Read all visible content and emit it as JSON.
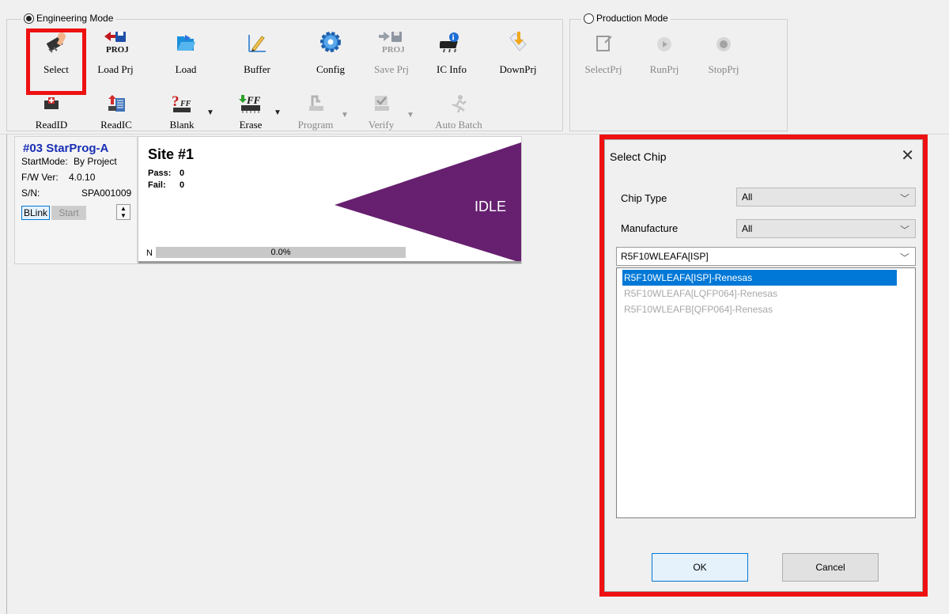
{
  "modes": {
    "engineering": "Engineering Mode",
    "production": "Production Mode"
  },
  "toolbar": {
    "row1": [
      "Select",
      "Load Prj",
      "Load",
      "Buffer",
      "Config",
      "Save Prj",
      "IC Info",
      "DownPrj"
    ],
    "row2": [
      "ReadID",
      "ReadIC",
      "Blank",
      "Erase",
      "Program",
      "Verify",
      "Auto Batch"
    ],
    "production": [
      "SelectPrj",
      "RunPrj",
      "StopPrj"
    ]
  },
  "device": {
    "title": "#03 StarProg-A",
    "start_mode_label": "StartMode:",
    "start_mode_value": "By Project",
    "fw_label": "F/W Ver:",
    "fw_value": "4.0.10",
    "sn_label": "S/N:",
    "sn_value": "SPA001009",
    "blink_label": "BLink",
    "start_label": "Start"
  },
  "site": {
    "title": "Site #1",
    "pass_label": "Pass:",
    "pass_value": "0",
    "fail_label": "Fail:",
    "fail_value": "0",
    "status": "IDLE",
    "progress_prefix": "N",
    "progress_text": "0.0%",
    "progress_fraction": 0.0
  },
  "dialog": {
    "title": "Select Chip",
    "close_glyph": "✕",
    "chip_type_label": "Chip Type",
    "chip_type_value": "All",
    "manufacture_label": "Manufacture",
    "manufacture_value": "All",
    "search_value": "R5F10WLEAFA[ISP]",
    "items": [
      "R5F10WLEAFA[ISP]-Renesas",
      "R5F10WLEAFA[LQFP064]-Renesas",
      "R5F10WLEAFB[QFP064]-Renesas"
    ],
    "ok_label": "OK",
    "cancel_label": "Cancel"
  },
  "colors": {
    "highlight": "#ee1111",
    "idle": "#66206f",
    "device_title": "#1a2fb5",
    "selection": "#0078d7"
  }
}
